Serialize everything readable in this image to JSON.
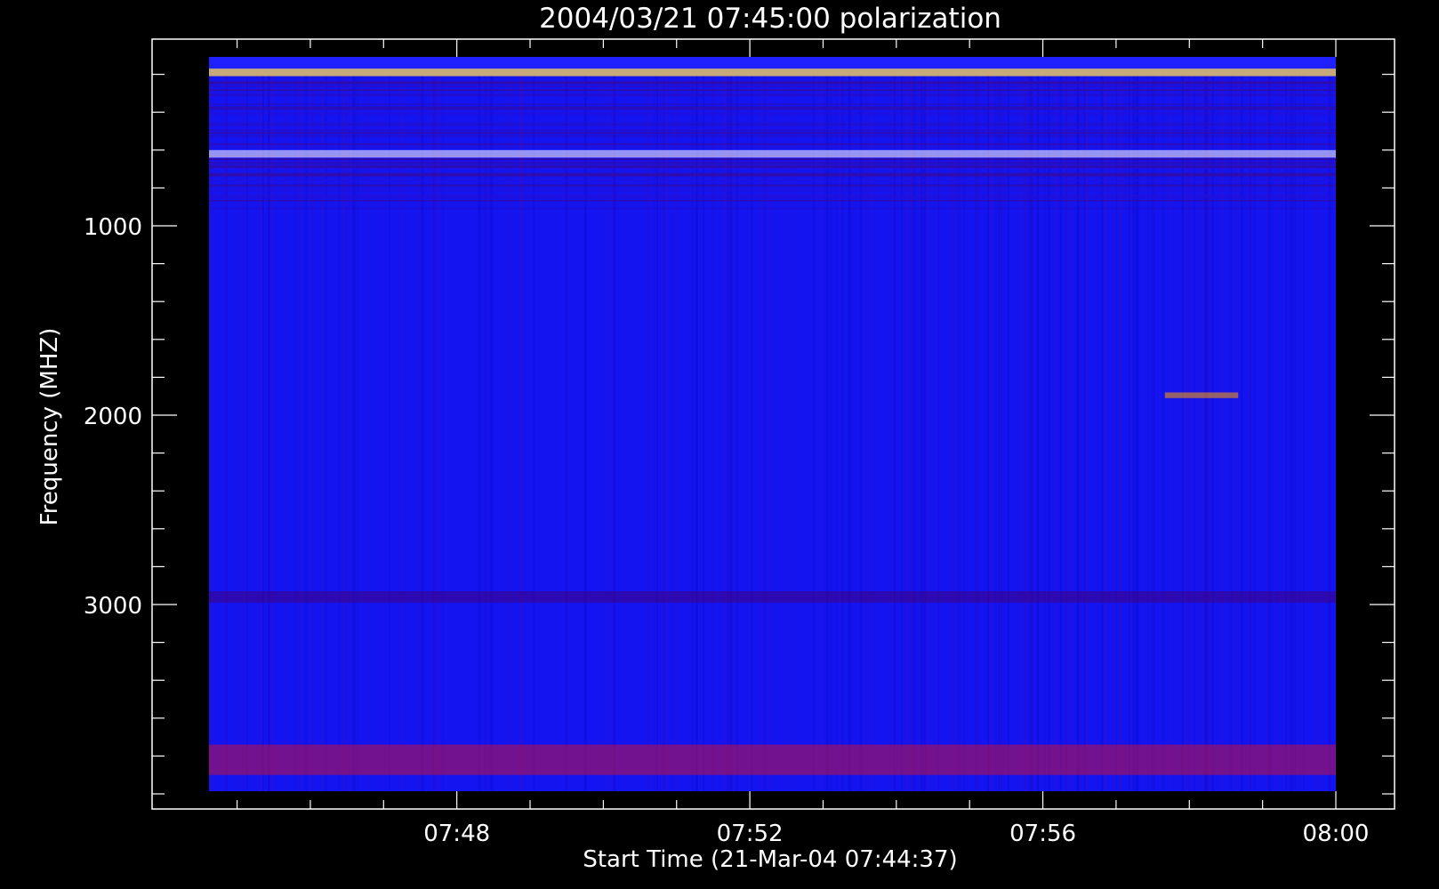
{
  "chart_data": {
    "type": "heatmap",
    "title": "2004/03/21 07:45:00 polarization",
    "xlabel": "Start Time (21-Mar-04 07:44:37)",
    "ylabel": "Frequency (MHZ)",
    "x_ticks": [
      "07:48",
      "07:52",
      "07:56",
      "08:00"
    ],
    "y_ticks": [
      "1000",
      "2000",
      "3000"
    ],
    "x_range": [
      "07:44:37",
      "08:00:00"
    ],
    "y_range": [
      0,
      4000
    ],
    "y_direction": "increasing-downward",
    "grid": false,
    "colorscale": [
      "#000000",
      "#0000ff",
      "#ff0000",
      "#ffff00",
      "#ffffff"
    ],
    "background_color": "#000000",
    "base_color": "#1414f0",
    "features": [
      {
        "label": "Strong emission near 08:00 end, top band",
        "freq_range": [
          170,
          210
        ],
        "color": "#ffd850"
      },
      {
        "label": "Interference line",
        "freq_range": [
          600,
          640
        ],
        "color": "#ffffff"
      },
      {
        "label": "Burst feature",
        "time_range": [
          "07:57:40",
          "07:58:40"
        ],
        "freq_range": [
          1880,
          1910
        ],
        "color": "#ffa000"
      },
      {
        "label": "Noise band",
        "freq_range": [
          2930,
          2990
        ],
        "color": "#400080"
      },
      {
        "label": "Noisy bottom edge",
        "freq_range": [
          3740,
          3900
        ],
        "color": "#c01040"
      }
    ]
  }
}
